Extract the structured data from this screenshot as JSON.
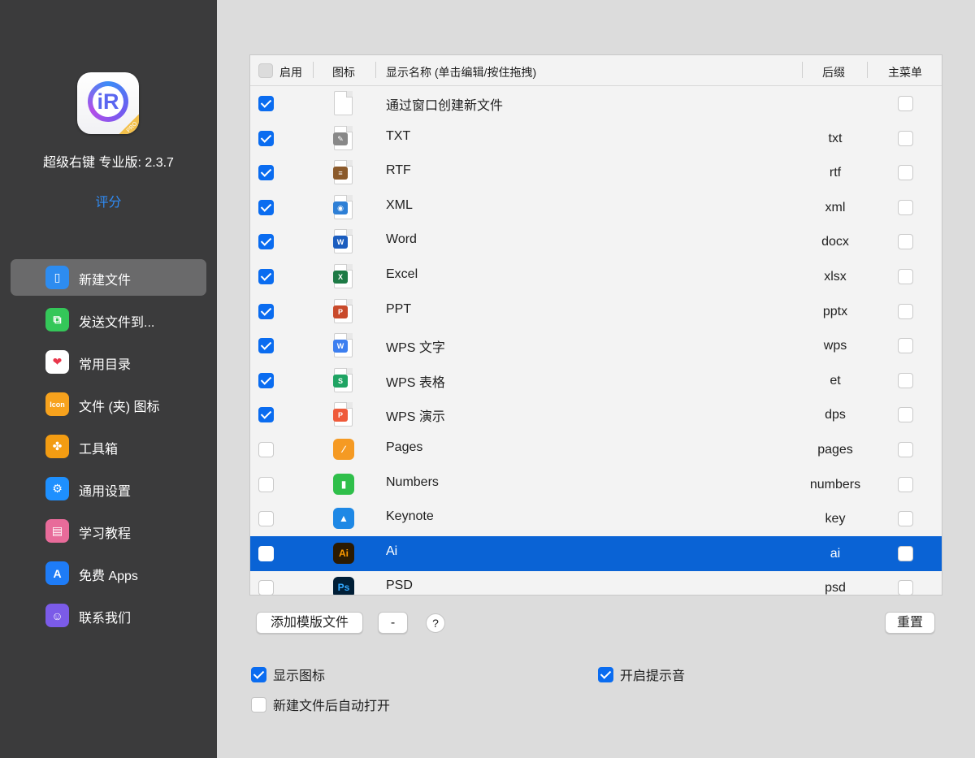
{
  "app": {
    "name_version": "超级右键 专业版: 2.3.7",
    "rate_label": "评分",
    "icon_letter": "iR",
    "badge_text": "PRO"
  },
  "sidebar": {
    "items": [
      {
        "label": "新建文件",
        "icon": "new-file-icon",
        "color": "#2d8cf0",
        "active": true
      },
      {
        "label": "发送文件到...",
        "icon": "send-file-icon",
        "color": "#34c759"
      },
      {
        "label": "常用目录",
        "icon": "heart-icon",
        "color": "#ffffff"
      },
      {
        "label": "文件 (夹) 图标",
        "icon": "icon-badge-icon",
        "color": "#f7a21d"
      },
      {
        "label": "工具箱",
        "icon": "toolbox-icon",
        "color": "#f39c12"
      },
      {
        "label": "通用设置",
        "icon": "gear-icon",
        "color": "#1e90ff"
      },
      {
        "label": "学习教程",
        "icon": "tutorial-icon",
        "color": "#e86b9a"
      },
      {
        "label": "免费 Apps",
        "icon": "app-store-icon",
        "color": "#1e7cf7"
      },
      {
        "label": "联系我们",
        "icon": "contact-icon",
        "color": "#7b5be8"
      }
    ]
  },
  "table": {
    "headers": {
      "enabled": "启用",
      "icon": "图标",
      "display_name": "显示名称 (单击编辑/按住拖拽)",
      "suffix": "后缀",
      "main_menu": "主菜单"
    },
    "rows": [
      {
        "name": "通过窗口创建新文件",
        "suffix": "",
        "enabled": true,
        "icon": "blank-file-icon"
      },
      {
        "name": "TXT",
        "suffix": "txt",
        "enabled": true,
        "icon": "txt-file-icon"
      },
      {
        "name": "RTF",
        "suffix": "rtf",
        "enabled": true,
        "icon": "rtf-file-icon"
      },
      {
        "name": "XML",
        "suffix": "xml",
        "enabled": true,
        "icon": "xml-file-icon"
      },
      {
        "name": "Word",
        "suffix": "docx",
        "enabled": true,
        "icon": "word-icon"
      },
      {
        "name": "Excel",
        "suffix": "xlsx",
        "enabled": true,
        "icon": "excel-icon"
      },
      {
        "name": "PPT",
        "suffix": "pptx",
        "enabled": true,
        "icon": "powerpoint-icon"
      },
      {
        "name": "WPS 文字",
        "suffix": "wps",
        "enabled": true,
        "icon": "wps-writer-icon"
      },
      {
        "name": "WPS 表格",
        "suffix": "et",
        "enabled": true,
        "icon": "wps-sheet-icon"
      },
      {
        "name": "WPS 演示",
        "suffix": "dps",
        "enabled": true,
        "icon": "wps-slides-icon"
      },
      {
        "name": "Pages",
        "suffix": "pages",
        "enabled": false,
        "icon": "pages-icon"
      },
      {
        "name": "Numbers",
        "suffix": "numbers",
        "enabled": false,
        "icon": "numbers-icon"
      },
      {
        "name": "Keynote",
        "suffix": "key",
        "enabled": false,
        "icon": "keynote-icon"
      },
      {
        "name": "Ai",
        "suffix": "ai",
        "enabled": false,
        "icon": "illustrator-icon",
        "selected": true
      },
      {
        "name": "PSD",
        "suffix": "psd",
        "enabled": false,
        "icon": "photoshop-icon"
      }
    ]
  },
  "buttons": {
    "add_template": "添加模版文件",
    "remove": "-",
    "help": "?",
    "reset": "重置"
  },
  "options": {
    "show_icon": "显示图标",
    "sound": "开启提示音",
    "auto_open": "新建文件后自动打开"
  }
}
